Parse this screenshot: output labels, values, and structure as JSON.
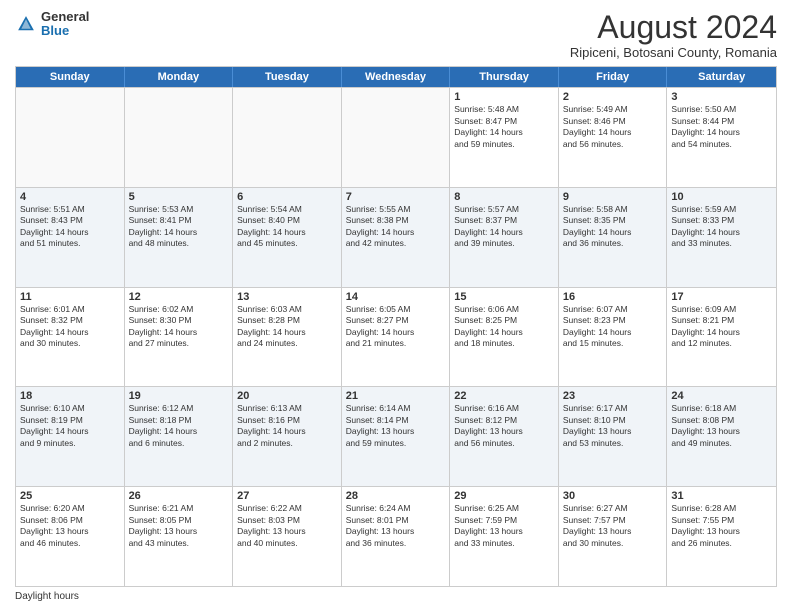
{
  "logo": {
    "general": "General",
    "blue": "Blue"
  },
  "title": "August 2024",
  "subtitle": "Ripiceni, Botosani County, Romania",
  "days": [
    "Sunday",
    "Monday",
    "Tuesday",
    "Wednesday",
    "Thursday",
    "Friday",
    "Saturday"
  ],
  "footer": "Daylight hours",
  "weeks": [
    [
      {
        "day": "",
        "info": ""
      },
      {
        "day": "",
        "info": ""
      },
      {
        "day": "",
        "info": ""
      },
      {
        "day": "",
        "info": ""
      },
      {
        "day": "1",
        "info": "Sunrise: 5:48 AM\nSunset: 8:47 PM\nDaylight: 14 hours\nand 59 minutes."
      },
      {
        "day": "2",
        "info": "Sunrise: 5:49 AM\nSunset: 8:46 PM\nDaylight: 14 hours\nand 56 minutes."
      },
      {
        "day": "3",
        "info": "Sunrise: 5:50 AM\nSunset: 8:44 PM\nDaylight: 14 hours\nand 54 minutes."
      }
    ],
    [
      {
        "day": "4",
        "info": "Sunrise: 5:51 AM\nSunset: 8:43 PM\nDaylight: 14 hours\nand 51 minutes."
      },
      {
        "day": "5",
        "info": "Sunrise: 5:53 AM\nSunset: 8:41 PM\nDaylight: 14 hours\nand 48 minutes."
      },
      {
        "day": "6",
        "info": "Sunrise: 5:54 AM\nSunset: 8:40 PM\nDaylight: 14 hours\nand 45 minutes."
      },
      {
        "day": "7",
        "info": "Sunrise: 5:55 AM\nSunset: 8:38 PM\nDaylight: 14 hours\nand 42 minutes."
      },
      {
        "day": "8",
        "info": "Sunrise: 5:57 AM\nSunset: 8:37 PM\nDaylight: 14 hours\nand 39 minutes."
      },
      {
        "day": "9",
        "info": "Sunrise: 5:58 AM\nSunset: 8:35 PM\nDaylight: 14 hours\nand 36 minutes."
      },
      {
        "day": "10",
        "info": "Sunrise: 5:59 AM\nSunset: 8:33 PM\nDaylight: 14 hours\nand 33 minutes."
      }
    ],
    [
      {
        "day": "11",
        "info": "Sunrise: 6:01 AM\nSunset: 8:32 PM\nDaylight: 14 hours\nand 30 minutes."
      },
      {
        "day": "12",
        "info": "Sunrise: 6:02 AM\nSunset: 8:30 PM\nDaylight: 14 hours\nand 27 minutes."
      },
      {
        "day": "13",
        "info": "Sunrise: 6:03 AM\nSunset: 8:28 PM\nDaylight: 14 hours\nand 24 minutes."
      },
      {
        "day": "14",
        "info": "Sunrise: 6:05 AM\nSunset: 8:27 PM\nDaylight: 14 hours\nand 21 minutes."
      },
      {
        "day": "15",
        "info": "Sunrise: 6:06 AM\nSunset: 8:25 PM\nDaylight: 14 hours\nand 18 minutes."
      },
      {
        "day": "16",
        "info": "Sunrise: 6:07 AM\nSunset: 8:23 PM\nDaylight: 14 hours\nand 15 minutes."
      },
      {
        "day": "17",
        "info": "Sunrise: 6:09 AM\nSunset: 8:21 PM\nDaylight: 14 hours\nand 12 minutes."
      }
    ],
    [
      {
        "day": "18",
        "info": "Sunrise: 6:10 AM\nSunset: 8:19 PM\nDaylight: 14 hours\nand 9 minutes."
      },
      {
        "day": "19",
        "info": "Sunrise: 6:12 AM\nSunset: 8:18 PM\nDaylight: 14 hours\nand 6 minutes."
      },
      {
        "day": "20",
        "info": "Sunrise: 6:13 AM\nSunset: 8:16 PM\nDaylight: 14 hours\nand 2 minutes."
      },
      {
        "day": "21",
        "info": "Sunrise: 6:14 AM\nSunset: 8:14 PM\nDaylight: 13 hours\nand 59 minutes."
      },
      {
        "day": "22",
        "info": "Sunrise: 6:16 AM\nSunset: 8:12 PM\nDaylight: 13 hours\nand 56 minutes."
      },
      {
        "day": "23",
        "info": "Sunrise: 6:17 AM\nSunset: 8:10 PM\nDaylight: 13 hours\nand 53 minutes."
      },
      {
        "day": "24",
        "info": "Sunrise: 6:18 AM\nSunset: 8:08 PM\nDaylight: 13 hours\nand 49 minutes."
      }
    ],
    [
      {
        "day": "25",
        "info": "Sunrise: 6:20 AM\nSunset: 8:06 PM\nDaylight: 13 hours\nand 46 minutes."
      },
      {
        "day": "26",
        "info": "Sunrise: 6:21 AM\nSunset: 8:05 PM\nDaylight: 13 hours\nand 43 minutes."
      },
      {
        "day": "27",
        "info": "Sunrise: 6:22 AM\nSunset: 8:03 PM\nDaylight: 13 hours\nand 40 minutes."
      },
      {
        "day": "28",
        "info": "Sunrise: 6:24 AM\nSunset: 8:01 PM\nDaylight: 13 hours\nand 36 minutes."
      },
      {
        "day": "29",
        "info": "Sunrise: 6:25 AM\nSunset: 7:59 PM\nDaylight: 13 hours\nand 33 minutes."
      },
      {
        "day": "30",
        "info": "Sunrise: 6:27 AM\nSunset: 7:57 PM\nDaylight: 13 hours\nand 30 minutes."
      },
      {
        "day": "31",
        "info": "Sunrise: 6:28 AM\nSunset: 7:55 PM\nDaylight: 13 hours\nand 26 minutes."
      }
    ]
  ]
}
